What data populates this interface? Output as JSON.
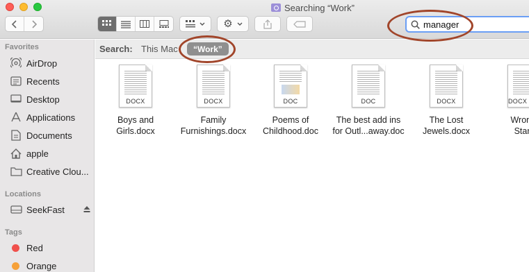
{
  "window": {
    "title": "Searching “Work”"
  },
  "toolbar": {
    "back_icon": "chevron-left-icon",
    "forward_icon": "chevron-right-icon",
    "view_modes": [
      "icon-view-icon",
      "list-view-icon",
      "column-view-icon",
      "gallery-view-icon"
    ],
    "group_icon": "group-by-icon",
    "action_icon": "gear-icon",
    "share_icon": "share-icon",
    "tag_icon": "tag-icon"
  },
  "search": {
    "value": "manager",
    "icon": "search-icon"
  },
  "scope_bar": {
    "label": "Search:",
    "this_mac": "This Mac",
    "work": "“Work”"
  },
  "sidebar": {
    "favorites_header": "Favorites",
    "favorites": [
      {
        "label": "AirDrop",
        "icon": "airdrop-icon"
      },
      {
        "label": "Recents",
        "icon": "recents-icon"
      },
      {
        "label": "Desktop",
        "icon": "desktop-icon"
      },
      {
        "label": "Applications",
        "icon": "applications-icon"
      },
      {
        "label": "Documents",
        "icon": "documents-icon"
      },
      {
        "label": "apple",
        "icon": "home-icon"
      },
      {
        "label": "Creative Clou...",
        "icon": "folder-icon"
      }
    ],
    "locations_header": "Locations",
    "locations": [
      {
        "label": "SeekFast",
        "icon": "drive-icon",
        "eject_icon": "eject-icon"
      }
    ],
    "tags_header": "Tags",
    "tags": [
      {
        "label": "Red",
        "color": "#f0504c"
      },
      {
        "label": "Orange",
        "color": "#f6a13a"
      }
    ]
  },
  "files": [
    {
      "name_line1": "Boys and",
      "name_line2": "Girls.docx",
      "type": "DOCX"
    },
    {
      "name_line1": "Family",
      "name_line2": "Furnishings.docx",
      "type": "DOCX"
    },
    {
      "name_line1": "Poems of",
      "name_line2": "Childhood.doc",
      "type": "DOC"
    },
    {
      "name_line1": "The best add ins",
      "name_line2": "for Outl...away.doc",
      "type": "DOC"
    },
    {
      "name_line1": "The Lost",
      "name_line2": "Jewels.docx",
      "type": "DOCX"
    },
    {
      "name_line1": "Wrong a",
      "name_line2": "Start.d",
      "type": "DOCX"
    }
  ],
  "colors": {
    "annotation": "#a1452a",
    "search_focus": "#6a9ef5",
    "scope_selected": "#8f8f8f"
  }
}
